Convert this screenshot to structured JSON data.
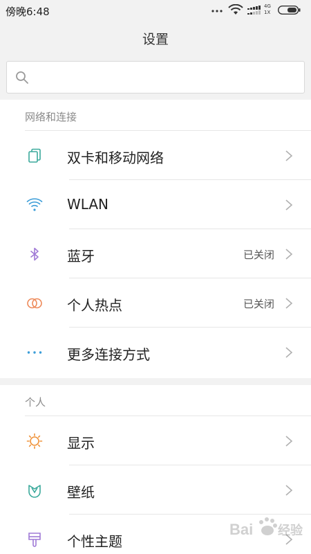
{
  "status_bar": {
    "time": "傍晚6:48",
    "network_label_top": "4G",
    "network_label_bottom": "1X"
  },
  "header": {
    "title": "设置"
  },
  "search": {
    "placeholder": ""
  },
  "sections": [
    {
      "header": "网络和连接",
      "items": [
        {
          "label": "双卡和移动网络",
          "status": "",
          "icon": "dual-sim-icon",
          "color": "#3aa99b"
        },
        {
          "label": "WLAN",
          "status": "",
          "icon": "wifi-icon",
          "color": "#3b9dd8"
        },
        {
          "label": "蓝牙",
          "status": "已关闭",
          "icon": "bluetooth-icon",
          "color": "#a07ad6"
        },
        {
          "label": "个人热点",
          "status": "已关闭",
          "icon": "hotspot-icon",
          "color": "#ee8a5a"
        },
        {
          "label": "更多连接方式",
          "status": "",
          "icon": "more-dots-icon",
          "color": "#3b9dd8"
        }
      ]
    },
    {
      "header": "个人",
      "items": [
        {
          "label": "显示",
          "status": "",
          "icon": "display-brightness-icon",
          "color": "#f0933a"
        },
        {
          "label": "壁纸",
          "status": "",
          "icon": "wallpaper-icon",
          "color": "#3aa99b"
        },
        {
          "label": "个性主题",
          "status": "",
          "icon": "theme-brush-icon",
          "color": "#a07ad6"
        }
      ]
    }
  ],
  "watermark": {
    "text": "Bai 经验",
    "is_logo": true
  }
}
